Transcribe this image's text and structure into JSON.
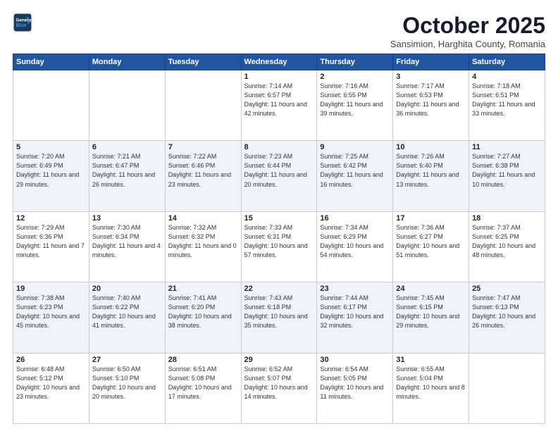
{
  "logo": {
    "line1": "General",
    "line2": "Blue"
  },
  "title": "October 2025",
  "subtitle": "Sansimion, Harghita County, Romania",
  "days_of_week": [
    "Sunday",
    "Monday",
    "Tuesday",
    "Wednesday",
    "Thursday",
    "Friday",
    "Saturday"
  ],
  "weeks": [
    [
      {
        "day": "",
        "info": ""
      },
      {
        "day": "",
        "info": ""
      },
      {
        "day": "",
        "info": ""
      },
      {
        "day": "1",
        "info": "Sunrise: 7:14 AM\nSunset: 6:57 PM\nDaylight: 11 hours and 42 minutes."
      },
      {
        "day": "2",
        "info": "Sunrise: 7:16 AM\nSunset: 6:55 PM\nDaylight: 11 hours and 39 minutes."
      },
      {
        "day": "3",
        "info": "Sunrise: 7:17 AM\nSunset: 6:53 PM\nDaylight: 11 hours and 36 minutes."
      },
      {
        "day": "4",
        "info": "Sunrise: 7:18 AM\nSunset: 6:51 PM\nDaylight: 11 hours and 33 minutes."
      }
    ],
    [
      {
        "day": "5",
        "info": "Sunrise: 7:20 AM\nSunset: 6:49 PM\nDaylight: 11 hours and 29 minutes."
      },
      {
        "day": "6",
        "info": "Sunrise: 7:21 AM\nSunset: 6:47 PM\nDaylight: 11 hours and 26 minutes."
      },
      {
        "day": "7",
        "info": "Sunrise: 7:22 AM\nSunset: 6:46 PM\nDaylight: 11 hours and 23 minutes."
      },
      {
        "day": "8",
        "info": "Sunrise: 7:23 AM\nSunset: 6:44 PM\nDaylight: 11 hours and 20 minutes."
      },
      {
        "day": "9",
        "info": "Sunrise: 7:25 AM\nSunset: 6:42 PM\nDaylight: 11 hours and 16 minutes."
      },
      {
        "day": "10",
        "info": "Sunrise: 7:26 AM\nSunset: 6:40 PM\nDaylight: 11 hours and 13 minutes."
      },
      {
        "day": "11",
        "info": "Sunrise: 7:27 AM\nSunset: 6:38 PM\nDaylight: 11 hours and 10 minutes."
      }
    ],
    [
      {
        "day": "12",
        "info": "Sunrise: 7:29 AM\nSunset: 6:36 PM\nDaylight: 11 hours and 7 minutes."
      },
      {
        "day": "13",
        "info": "Sunrise: 7:30 AM\nSunset: 6:34 PM\nDaylight: 11 hours and 4 minutes."
      },
      {
        "day": "14",
        "info": "Sunrise: 7:32 AM\nSunset: 6:32 PM\nDaylight: 11 hours and 0 minutes."
      },
      {
        "day": "15",
        "info": "Sunrise: 7:33 AM\nSunset: 6:31 PM\nDaylight: 10 hours and 57 minutes."
      },
      {
        "day": "16",
        "info": "Sunrise: 7:34 AM\nSunset: 6:29 PM\nDaylight: 10 hours and 54 minutes."
      },
      {
        "day": "17",
        "info": "Sunrise: 7:36 AM\nSunset: 6:27 PM\nDaylight: 10 hours and 51 minutes."
      },
      {
        "day": "18",
        "info": "Sunrise: 7:37 AM\nSunset: 6:25 PM\nDaylight: 10 hours and 48 minutes."
      }
    ],
    [
      {
        "day": "19",
        "info": "Sunrise: 7:38 AM\nSunset: 6:23 PM\nDaylight: 10 hours and 45 minutes."
      },
      {
        "day": "20",
        "info": "Sunrise: 7:40 AM\nSunset: 6:22 PM\nDaylight: 10 hours and 41 minutes."
      },
      {
        "day": "21",
        "info": "Sunrise: 7:41 AM\nSunset: 6:20 PM\nDaylight: 10 hours and 38 minutes."
      },
      {
        "day": "22",
        "info": "Sunrise: 7:43 AM\nSunset: 6:18 PM\nDaylight: 10 hours and 35 minutes."
      },
      {
        "day": "23",
        "info": "Sunrise: 7:44 AM\nSunset: 6:17 PM\nDaylight: 10 hours and 32 minutes."
      },
      {
        "day": "24",
        "info": "Sunrise: 7:45 AM\nSunset: 6:15 PM\nDaylight: 10 hours and 29 minutes."
      },
      {
        "day": "25",
        "info": "Sunrise: 7:47 AM\nSunset: 6:13 PM\nDaylight: 10 hours and 26 minutes."
      }
    ],
    [
      {
        "day": "26",
        "info": "Sunrise: 6:48 AM\nSunset: 5:12 PM\nDaylight: 10 hours and 23 minutes."
      },
      {
        "day": "27",
        "info": "Sunrise: 6:50 AM\nSunset: 5:10 PM\nDaylight: 10 hours and 20 minutes."
      },
      {
        "day": "28",
        "info": "Sunrise: 6:51 AM\nSunset: 5:08 PM\nDaylight: 10 hours and 17 minutes."
      },
      {
        "day": "29",
        "info": "Sunrise: 6:52 AM\nSunset: 5:07 PM\nDaylight: 10 hours and 14 minutes."
      },
      {
        "day": "30",
        "info": "Sunrise: 6:54 AM\nSunset: 5:05 PM\nDaylight: 10 hours and 11 minutes."
      },
      {
        "day": "31",
        "info": "Sunrise: 6:55 AM\nSunset: 5:04 PM\nDaylight: 10 hours and 8 minutes."
      },
      {
        "day": "",
        "info": ""
      }
    ]
  ]
}
